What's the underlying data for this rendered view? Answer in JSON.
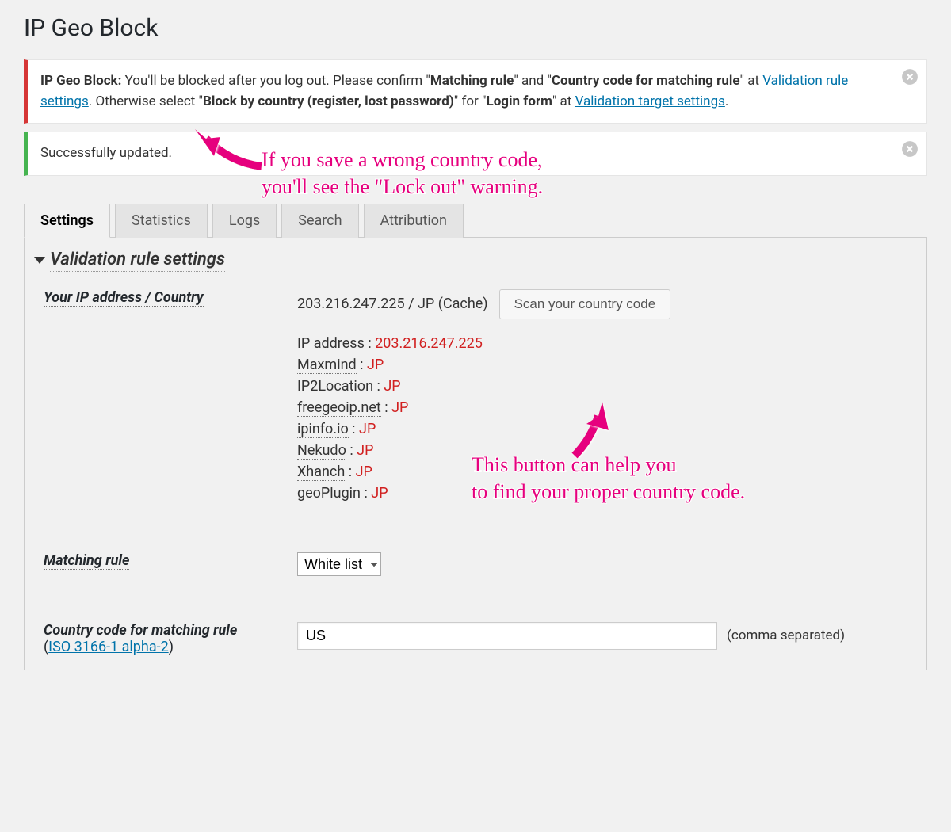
{
  "page_title": "IP Geo Block",
  "notice_warning": {
    "lead": "IP Geo Block:",
    "msg_part1": " You'll be blocked after you log out. Please confirm ",
    "quoted1": "Matching rule",
    "and": " and ",
    "quoted2": "Country code for matching rule",
    "at1": " at ",
    "link1": "Validation rule settings",
    "msg_part2": ". Otherwise select ",
    "quoted3": "Block by country (register, lost password)",
    "for": " for ",
    "quoted4": "Login form",
    "at2": " at ",
    "link2": "Validation target settings",
    "period": "."
  },
  "notice_success": "Successfully updated.",
  "tabs": [
    "Settings",
    "Statistics",
    "Logs",
    "Search",
    "Attribution"
  ],
  "active_tab": "Settings",
  "section_title": "Validation rule settings",
  "rows": {
    "ip_country_label": "Your IP address / Country",
    "ip_country_value": "203.216.247.225 / JP (Cache)",
    "scan_button": "Scan your country code",
    "ip_address_label": "IP address :",
    "ip_address_value": "203.216.247.225",
    "providers": [
      {
        "name": "Maxmind",
        "value": "JP"
      },
      {
        "name": "IP2Location",
        "value": "JP"
      },
      {
        "name": "freegeoip.net",
        "value": "JP"
      },
      {
        "name": "ipinfo.io",
        "value": "JP"
      },
      {
        "name": "Nekudo",
        "value": "JP"
      },
      {
        "name": "Xhanch",
        "value": "JP"
      },
      {
        "name": "geoPlugin",
        "value": "JP"
      }
    ],
    "matching_rule_label": "Matching rule",
    "matching_rule_value": "White list",
    "country_code_label": "Country code for matching rule",
    "country_code_sublabel_open": "(",
    "country_code_link": "ISO 3166-1 alpha-2",
    "country_code_sublabel_close": ")",
    "country_code_value": "US",
    "country_code_hint": "(comma separated)"
  },
  "annotations": {
    "top": "If you save a wrong country code,\nyou'll see the \"Lock out\" warning.",
    "right": "This button can help you\nto find your proper country code."
  }
}
